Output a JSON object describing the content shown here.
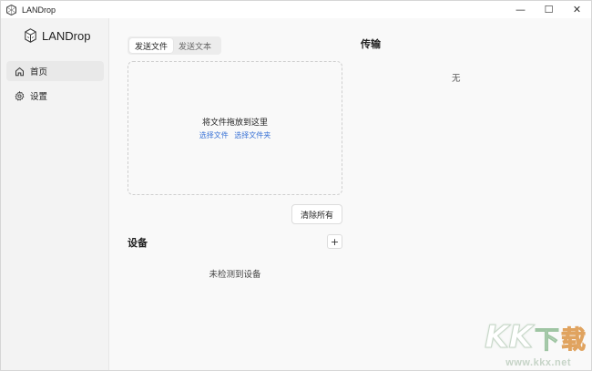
{
  "window": {
    "title": "LANDrop"
  },
  "controls": {
    "minimize": "—",
    "maximize": "☐",
    "close": "✕"
  },
  "sidebar": {
    "brand": "LANDrop",
    "items": [
      {
        "label": "首页",
        "icon": "home-icon",
        "active": true
      },
      {
        "label": "设置",
        "icon": "gear-icon",
        "active": false
      }
    ]
  },
  "send": {
    "tabs": [
      {
        "label": "发送文件",
        "selected": true
      },
      {
        "label": "发送文本",
        "selected": false
      }
    ],
    "drop_title": "将文件拖放到这里",
    "select_file": "选择文件",
    "select_folder": "选择文件夹",
    "clear_all": "清除所有"
  },
  "devices": {
    "title": "设备",
    "add_label": "+",
    "empty": "未检测到设备"
  },
  "transfer": {
    "title": "传输",
    "empty": "无"
  },
  "watermark": {
    "k1": "K",
    "k2": "K",
    "xia": "下",
    "zai": "载",
    "url": "www.kkx.net"
  },
  "colors": {
    "accent": "#3a73d6"
  }
}
